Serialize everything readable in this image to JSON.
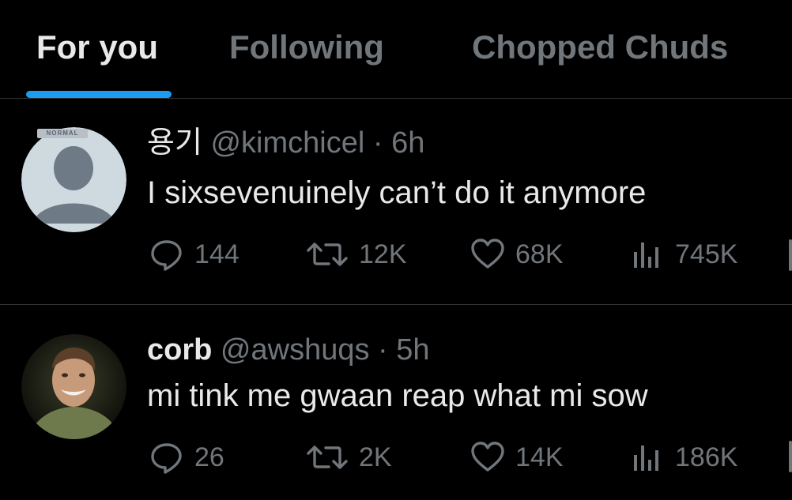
{
  "tabs": [
    {
      "label": "For you",
      "active": true
    },
    {
      "label": "Following",
      "active": false
    },
    {
      "label": "Chopped Chuds",
      "active": false
    }
  ],
  "colors": {
    "background": "#000000",
    "text_primary": "#e7e9ea",
    "text_secondary": "#71767b",
    "accent": "#1d9bf0",
    "divider": "#2f3336"
  },
  "tweets": [
    {
      "name": "용기",
      "handle": "@kimchicel",
      "separator": "·",
      "time": "6h",
      "text": "I sixsevenuinely can’t do it anymore",
      "avatar_badge": "NORMAL",
      "avatar_icon": "default-profile-avatar",
      "replies": "144",
      "reposts": "12K",
      "likes": "68K",
      "views": "745K"
    },
    {
      "name": "corb",
      "handle": "@awshuqs",
      "separator": "·",
      "time": "5h",
      "text": "mi tink me gwaan reap what mi sow",
      "avatar_icon": "profile-photo-avatar",
      "replies": "26",
      "reposts": "2K",
      "likes": "14K",
      "views": "186K"
    }
  ]
}
